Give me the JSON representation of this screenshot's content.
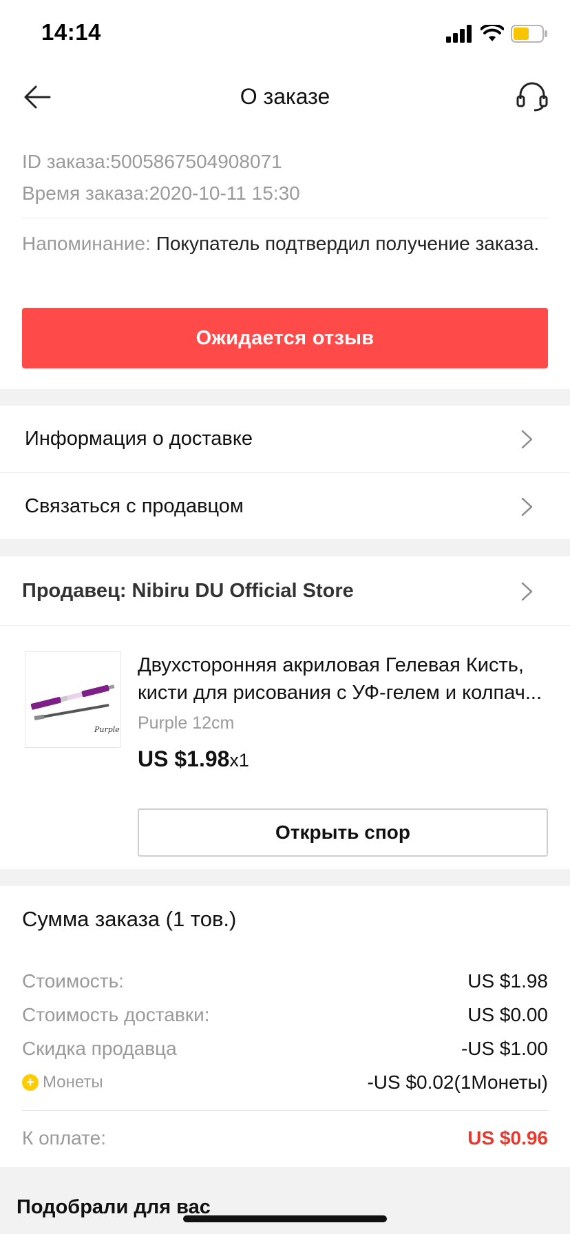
{
  "status_bar": {
    "time": "14:14",
    "signal_icon": "cellular-signal-icon",
    "wifi_icon": "wifi-icon",
    "battery_icon": "battery-low-icon",
    "battery_color": "#f7c600"
  },
  "nav": {
    "title": "О заказе",
    "back_icon": "arrow-left-icon",
    "support_icon": "headset-icon"
  },
  "order": {
    "id_line": "ID заказа:5005867504908071",
    "time_line": "Время заказа:2020-10-11 15:30",
    "reminder_label": "Напоминание:",
    "reminder_text": " Покупатель подтвердил получение заказа."
  },
  "primary_button": {
    "label": "Ожидается отзыв",
    "color": "#ff4a4a"
  },
  "links": {
    "delivery": "Информация о доставке",
    "contact_seller": "Связаться с продавцом",
    "chevron_icon": "chevron-right-icon"
  },
  "seller": {
    "label": "Продавец: Nibiru DU Official Store"
  },
  "product": {
    "image_icon": "product-brush-image",
    "title": "Двухсторонняя акриловая Гелевая Кисть, кисти для рисования с УФ-гелем и колпач...",
    "variant": "Purple 12cm",
    "price": "US $1.98",
    "quantity": "x1",
    "dispute_label": "Открыть спор"
  },
  "summary": {
    "title": "Сумма заказа (1 тов.)",
    "rows": [
      {
        "label": "Стоимость:",
        "value": "US $1.98"
      },
      {
        "label": "Стоимость доставки:",
        "value": "US $0.00"
      },
      {
        "label": "Скидка продавца",
        "value": "-US $1.00"
      },
      {
        "label": "Монеты",
        "value": "-US $0.02(1Монеты)"
      }
    ],
    "coin_icon": "coin-icon",
    "total_label": "К оплате:",
    "total_value": "US $0.96",
    "total_color": "#e8392f"
  },
  "recommendations": {
    "title": "Подобрали для вас"
  }
}
